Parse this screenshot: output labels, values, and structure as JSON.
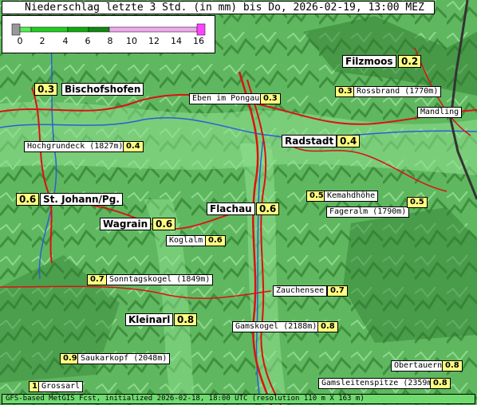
{
  "title": "Niederschlag letzte 3 Std. (in mm) bis Do, 2026-02-19, 13:00 MEZ",
  "footer": "GFS-based MetGIS Fcst, initialized 2026-02-18, 18:00 UTC  (resolution 110 m X 163 m)",
  "legend": {
    "ticks": [
      "0",
      "2",
      "4",
      "6",
      "8",
      "10",
      "12",
      "14",
      "16"
    ],
    "colors": [
      "#999999",
      "#22cc22",
      "#11aa11",
      "#118811",
      "#eeaaee",
      "#ff44ff"
    ]
  },
  "colors": {
    "road": "#dd1111",
    "river": "#2a5fd6",
    "value_bg": "#ffff80",
    "border": "#333333"
  },
  "places": [
    {
      "name": "Filzmoos",
      "value": "0.2"
    },
    {
      "name": "Bischofshofen",
      "value": "0.3"
    },
    {
      "name": "Eben im Pongau",
      "value": "0.3"
    },
    {
      "name": "Rossbrand (1770m)",
      "value": "0.3"
    },
    {
      "name": "Mandling",
      "value": ""
    },
    {
      "name": "Radstadt",
      "value": "0.4"
    },
    {
      "name": "Hochgrundeck (1827m)",
      "value": "0.4"
    },
    {
      "name": "St. Johann/Pg.",
      "value": "0.6"
    },
    {
      "name": "Kemahdhöhe",
      "value": "0.5"
    },
    {
      "name": "Fageralm (1790m)",
      "value": "0.5"
    },
    {
      "name": "Flachau",
      "value": "0.6"
    },
    {
      "name": "Wagrain",
      "value": "0.6"
    },
    {
      "name": "Koglalm",
      "value": "0.6"
    },
    {
      "name": "Sonntagskogel (1849m)",
      "value": "0.7"
    },
    {
      "name": "Zauchensee",
      "value": "0.7"
    },
    {
      "name": "Kleinarl",
      "value": "0.8"
    },
    {
      "name": "Gamskogel (2188m)",
      "value": "0.8"
    },
    {
      "name": "Saukarkopf (2048m)",
      "value": "0.9"
    },
    {
      "name": "Obertauern",
      "value": "0.8"
    },
    {
      "name": "Grossarl",
      "value": "1."
    },
    {
      "name": "Gamsleitenspitze (2359m)",
      "value": "0.8"
    }
  ]
}
